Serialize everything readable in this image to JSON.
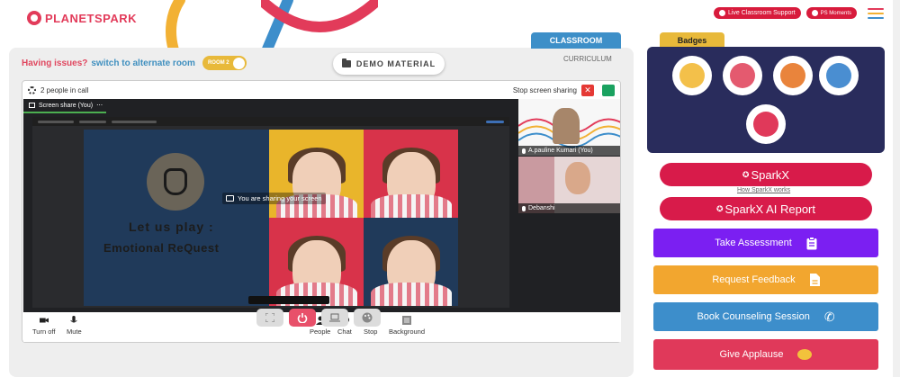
{
  "brand": {
    "name": "PLANETSPARK"
  },
  "top_bar": {
    "support_label": "Live Classroom Support",
    "moments_label": "PS Moments"
  },
  "main": {
    "issue_text": "Having issues?",
    "issue_link": "switch to alternate room",
    "room_label": "ROOM 2",
    "demo_material_label": "DEMO MATERIAL",
    "classroom_tab": "CLASSROOM",
    "curriculum_label": "CURRICULUM"
  },
  "call": {
    "people_count": "2 people in call",
    "stop_sharing_label": "Stop screen sharing",
    "screen_share_label": "Screen share (You)",
    "sharing_message": "You are sharing your screen",
    "slide_line1": "Let us play :",
    "slide_line2": "Emotional ReQuest",
    "participants": [
      {
        "name": "A.pauline Kumari (You)"
      },
      {
        "name": "Debanshi"
      }
    ],
    "controls": {
      "turn_off": "Turn off",
      "mute": "Mute",
      "people": "People",
      "chat": "Chat",
      "stop": "Stop",
      "background": "Background"
    }
  },
  "right": {
    "badges_title": "Badges",
    "sparkx_label": "SparkX",
    "how_sparkx": "How SparkX works",
    "sparkx_ai_label": "SparkX AI Report",
    "actions": [
      {
        "label": "Take Assessment",
        "icon": "clipboard-icon",
        "color": "#7b1ff2"
      },
      {
        "label": "Request Feedback",
        "icon": "document-icon",
        "color": "#f2a62f"
      },
      {
        "label": "Book Counseling Session",
        "icon": "phone-icon",
        "color": "#3d8ecb"
      },
      {
        "label": "Give Applause",
        "icon": "clap-icon",
        "color": "#e0395a"
      }
    ]
  },
  "colors": {
    "brand_red": "#e23b5a",
    "link_blue": "#3f8fbf",
    "badge_panel": "#292c5c",
    "badge_tab": "#e8b93a"
  }
}
